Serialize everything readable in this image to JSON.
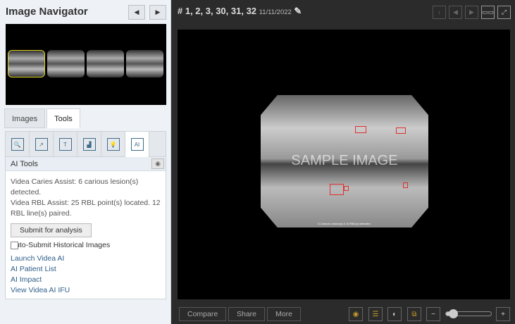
{
  "navigator": {
    "title": "Image Navigator",
    "prev": "◀",
    "next": "▶"
  },
  "tabs": [
    {
      "label": "Images"
    },
    {
      "label": "Tools"
    }
  ],
  "tools": {
    "icons": [
      "zoom-tool",
      "report",
      "measure",
      "histogram",
      "light",
      "AI"
    ],
    "ai_title": "AI Tools",
    "caries": "Videa Caries Assist: 6 carious lesion(s) detected.",
    "rbl": "Videa RBL Assist: 25 RBL point(s) located. 12 RBL line(s) paired.",
    "submit": "Submit for analysis",
    "auto_submit": "Auto-Submit Historical Images",
    "links": [
      "Launch Videa AI",
      "AI Patient List",
      "AI Impact",
      "View Videa AI IFU"
    ]
  },
  "viewer": {
    "teeth": "# 1, 2, 3, 30, 31, 32",
    "date": "11/11/2022",
    "watermark": "SAMPLE IMAGE",
    "caption": "6 Carious Lesion(s) & 10 RBL(s) detected.",
    "zoom_level": 0.1
  },
  "footer": {
    "compare": "Compare",
    "share": "Share",
    "more": "More",
    "minus": "−",
    "plus": "+"
  }
}
